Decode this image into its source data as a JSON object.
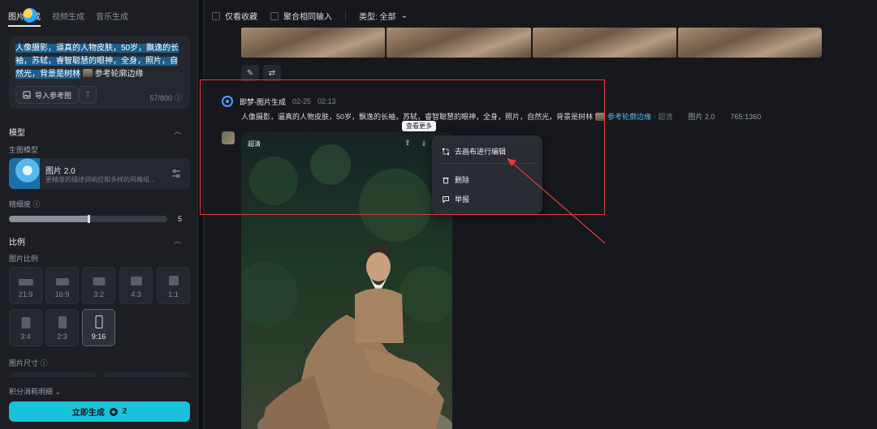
{
  "left_panel": {
    "tabs": [
      "图片生成",
      "视频生成",
      "音乐生成"
    ],
    "prompt": {
      "text_main": "人像摄影，逼真的人物皮肤，50岁，飘逸的长袖，苏轼，睿智聪慧的眼神，全身，照片，自然光，背景是树林",
      "ref_label": "参考轮廓边缘",
      "import_label": "导入参考图",
      "counter": "57/800"
    },
    "model_section": {
      "title": "模型",
      "sub_label": "生图模型",
      "model_name": "图片 2.0",
      "model_desc": "更精准的描述词响应和多样的风格组...",
      "precision_label": "精细度",
      "precision_value": "5",
      "precision_fraction": 0.5
    },
    "ratio_section": {
      "title": "比例",
      "sub_label": "图片比例",
      "ratios": [
        "21:9",
        "16:9",
        "3:2",
        "4:3",
        "1:1",
        "3:4",
        "2:3",
        "9:16"
      ],
      "selected": "9:16",
      "size_label": "图片尺寸"
    },
    "points_label": "积分消耗明细",
    "generate": {
      "label": "立即生成",
      "cost": "2"
    }
  },
  "main": {
    "filters": {
      "only_favorites": "仅看收藏",
      "merge_same": "聚合相同输入",
      "type_label": "类型: 全部"
    },
    "gen_header": {
      "name": "即梦-图片生成",
      "date": "02-25",
      "time": "02:13"
    },
    "gen_prompt": {
      "text": "人像摄影，逼真的人物皮肤，50岁，飘逸的长袖，苏轼，睿智聪慧的眼神，全身，照片，自然光，背景是树林",
      "ref": "参考轮廓边缘",
      "quality": "· 超清",
      "model": "图片 2.0",
      "size": "765:1360"
    },
    "image": {
      "quality_label": "超清"
    },
    "tooltip": "查看更多",
    "menu": {
      "edit": "去画布进行编辑",
      "delete": "删除",
      "report": "举报"
    }
  },
  "colors": {
    "accent": "#19c1d9",
    "annotation": "#e03a3a",
    "link": "#5ab8f0"
  }
}
